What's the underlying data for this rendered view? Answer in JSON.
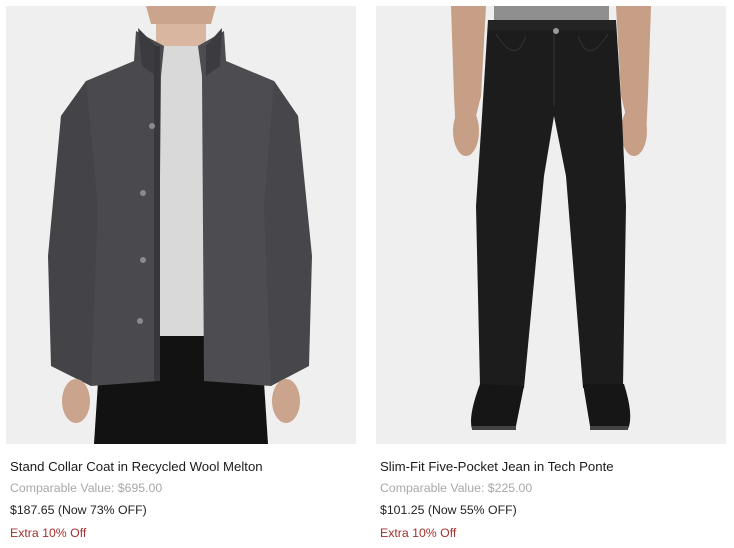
{
  "products": [
    {
      "title": "Stand Collar Coat in Recycled Wool Melton",
      "comparable_value": "Comparable Value: $695.00",
      "price": "$187.65 (Now 73% OFF)",
      "promo": "Extra 10% Off",
      "image_name": "coat-image"
    },
    {
      "title": "Slim-Fit Five-Pocket Jean in Tech Ponte",
      "comparable_value": "Comparable Value: $225.00",
      "price": "$101.25 (Now 55% OFF)",
      "promo": "Extra 10% Off",
      "image_name": "jean-image"
    }
  ],
  "colors": {
    "image_bg": "#efefef",
    "comparable": "#a8a8a8",
    "promo": "#a2322d",
    "coat": "#4a4a4e",
    "jean": "#1c1c1c"
  }
}
